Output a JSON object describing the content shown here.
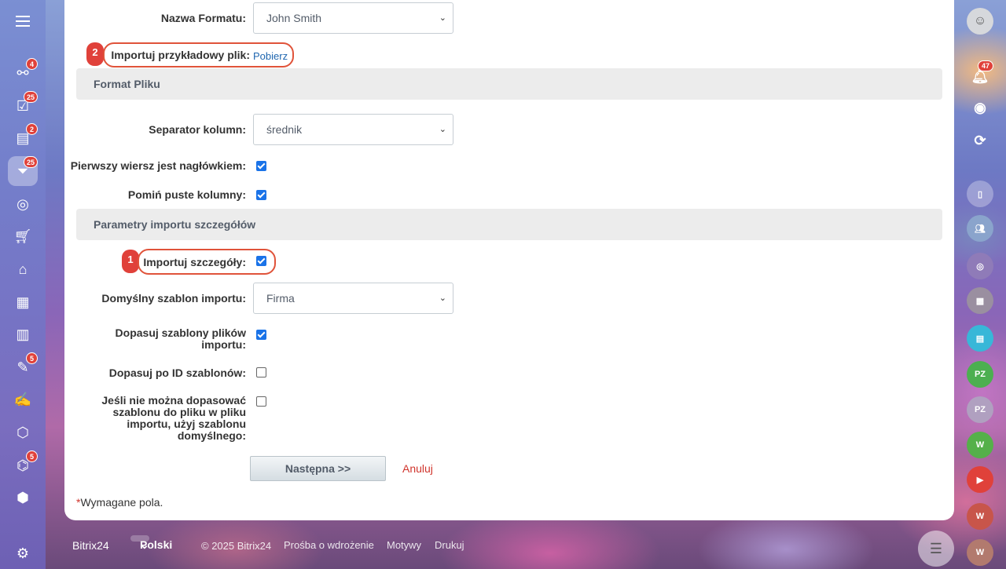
{
  "form": {
    "format_name_label": "Nazwa Formatu:",
    "format_name_value": "John Smith",
    "sample_file_label": "Importuj przykładowy plik:",
    "sample_file_link": "Pobierz",
    "section_file_format": "Format Pliku",
    "column_separator_label": "Separator kolumn:",
    "column_separator_value": "średnik",
    "first_row_header_label": "Pierwszy wiersz jest nagłówkiem:",
    "first_row_header_checked": true,
    "skip_empty_label": "Pomiń puste kolumny:",
    "skip_empty_checked": true,
    "section_details": "Parametry importu szczegółów",
    "import_details_label": "Importuj szczegóły:",
    "import_details_checked": true,
    "default_template_label": "Domyślny szablon importu:",
    "default_template_value": "Firma",
    "match_templates_label_line1": "Dopasuj szablony plików",
    "match_templates_label_line2": "importu:",
    "match_templates_checked": true,
    "match_by_id_label": "Dopasuj po ID szablonów:",
    "match_by_id_checked": false,
    "fallback_label_line1": "Jeśli nie można dopasować",
    "fallback_label_line2": "szablonu do pliku w pliku",
    "fallback_label_line3": "importu, użyj szablonu",
    "fallback_label_line4": "domyślnego:",
    "fallback_checked": false,
    "next_button": "Następna >>",
    "cancel_link": "Anuluj",
    "required_star": "*",
    "required_note": "Wymagane pola."
  },
  "callouts": {
    "sample_file_number": "2",
    "import_details_number": "1"
  },
  "sidebar": {
    "badges": [
      "4",
      "25",
      "2",
      "25",
      "5",
      "5"
    ]
  },
  "rightbar": {
    "notifications_badge": "47",
    "avatars": [
      "PZ",
      "PZ",
      "W",
      "W",
      "W"
    ]
  },
  "footer": {
    "brand": "Bitrix24",
    "language": "Polski",
    "copyright": "© 2025 Bitrix24",
    "link_implementation": "Prośba o wdrożenie",
    "link_themes": "Motywy",
    "link_print": "Drukuj"
  },
  "colors": {
    "accent_red": "#e0413a",
    "checkbox_blue": "#1a73e8",
    "cancel_red": "#d0342c"
  }
}
